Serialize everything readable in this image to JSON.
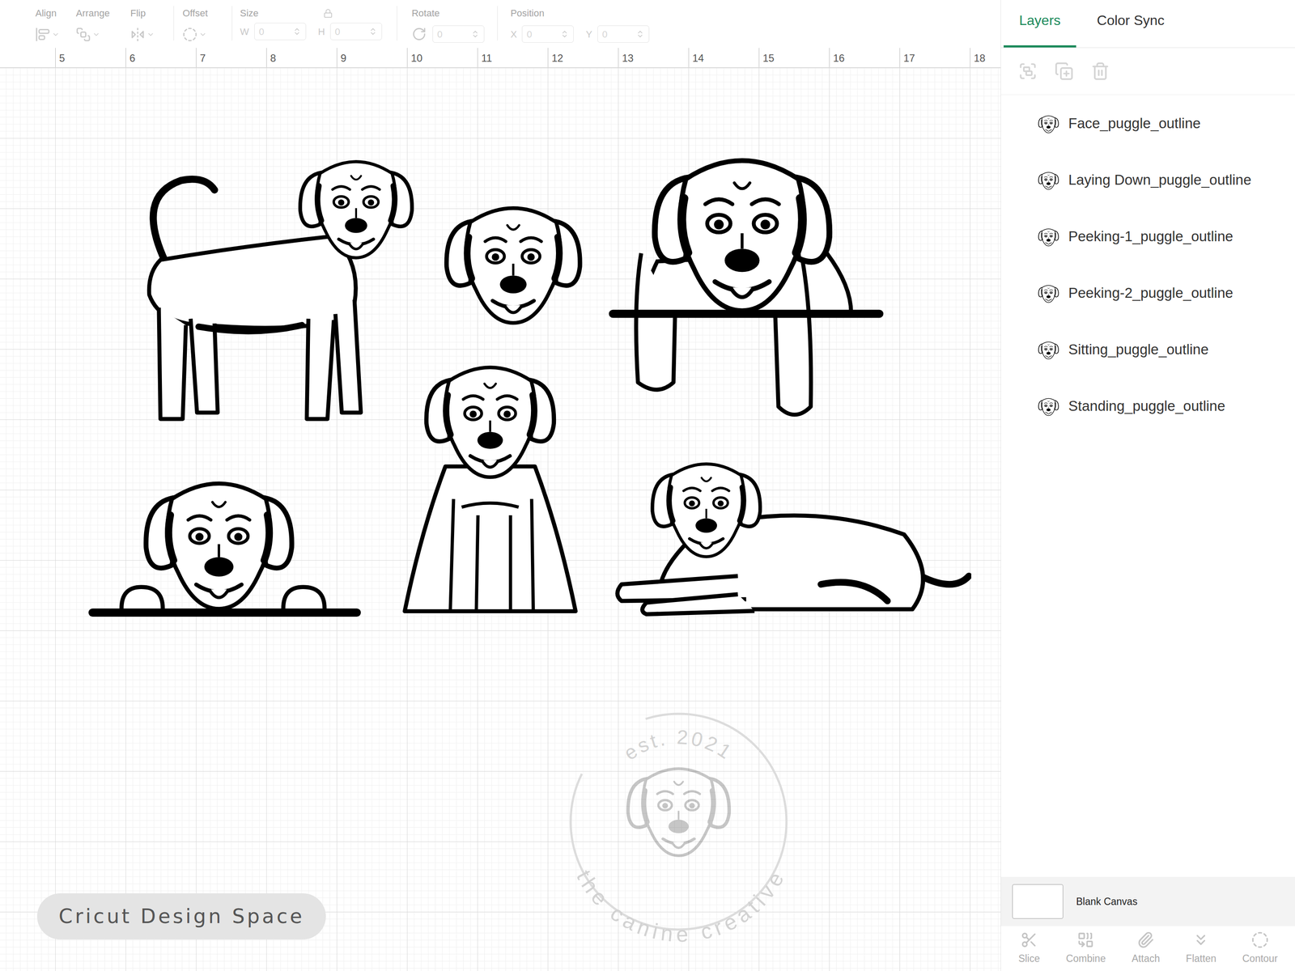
{
  "toolbar": {
    "disabled": true,
    "align": {
      "label": "Align"
    },
    "arrange": {
      "label": "Arrange"
    },
    "flip": {
      "label": "Flip"
    },
    "offset": {
      "label": "Offset"
    },
    "size": {
      "label": "Size",
      "w_label": "W",
      "w": "0",
      "h_label": "H",
      "h": "0"
    },
    "rotate": {
      "label": "Rotate",
      "value": "0"
    },
    "position": {
      "label": "Position",
      "x_label": "X",
      "x": "0",
      "y_label": "Y",
      "y": "0"
    }
  },
  "ruler": [
    "5",
    "6",
    "7",
    "8",
    "9",
    "10",
    "11",
    "12",
    "13",
    "14",
    "15",
    "16",
    "17",
    "18"
  ],
  "tabs": [
    {
      "label": "Layers",
      "selected": true
    },
    {
      "label": "Color Sync",
      "selected": false
    }
  ],
  "layers": [
    {
      "name": "Face_puggle_outline",
      "selected": false
    },
    {
      "name": "Laying Down_puggle_outline",
      "selected": false
    },
    {
      "name": "Peeking-1_puggle_outline",
      "selected": false
    },
    {
      "name": "Peeking-2_puggle_outline",
      "selected": false
    },
    {
      "name": "Sitting_puggle_outline",
      "selected": false
    },
    {
      "name": "Standing_puggle_outline",
      "selected": false
    }
  ],
  "canvas_swatch": {
    "label": "Blank Canvas"
  },
  "actions": [
    {
      "label": "Slice",
      "disabled": true
    },
    {
      "label": "Combine",
      "disabled": true
    },
    {
      "label": "Attach",
      "disabled": true
    },
    {
      "label": "Flatten",
      "disabled": true
    },
    {
      "label": "Contour",
      "disabled": true
    }
  ],
  "watermark": {
    "top": "est. 2021",
    "bottom": "the canine creative"
  },
  "badge": "Cricut Design Space"
}
